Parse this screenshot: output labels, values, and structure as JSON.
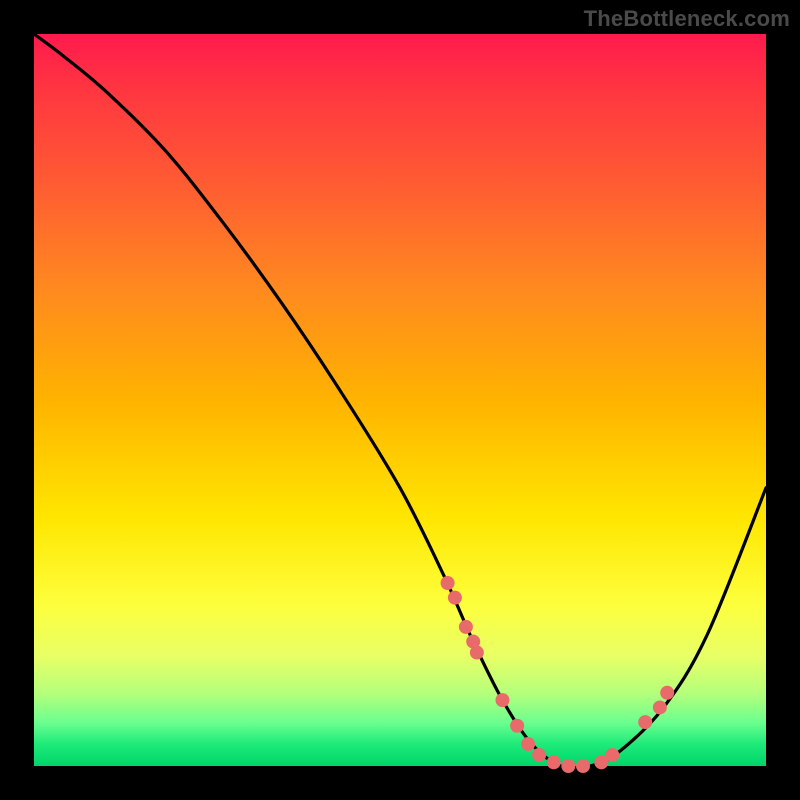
{
  "watermark": "TheBottleneck.com",
  "chart_data": {
    "type": "line",
    "title": "",
    "xlabel": "",
    "ylabel": "",
    "xlim": [
      0,
      100
    ],
    "ylim": [
      0,
      100
    ],
    "curve": {
      "x": [
        0,
        4,
        10,
        18,
        26,
        34,
        42,
        50,
        56,
        60,
        64,
        68,
        72,
        76,
        80,
        86,
        92,
        100
      ],
      "y": [
        100,
        97,
        92,
        84,
        74,
        63,
        51,
        38,
        26,
        17,
        9,
        3,
        0,
        0,
        2,
        8,
        18,
        38
      ]
    },
    "markers": {
      "x": [
        56.5,
        57.5,
        59.0,
        60.0,
        60.5,
        64.0,
        66.0,
        67.5,
        69.0,
        71.0,
        73.0,
        75.0,
        77.5,
        79.0,
        83.5,
        85.5,
        86.5
      ],
      "y": [
        25.0,
        23.0,
        19.0,
        17.0,
        15.5,
        9.0,
        5.5,
        3.0,
        1.5,
        0.5,
        0.0,
        0.0,
        0.5,
        1.5,
        6.0,
        8.0,
        10.0
      ],
      "color": "#e86a6a",
      "radius_px": 7
    }
  }
}
